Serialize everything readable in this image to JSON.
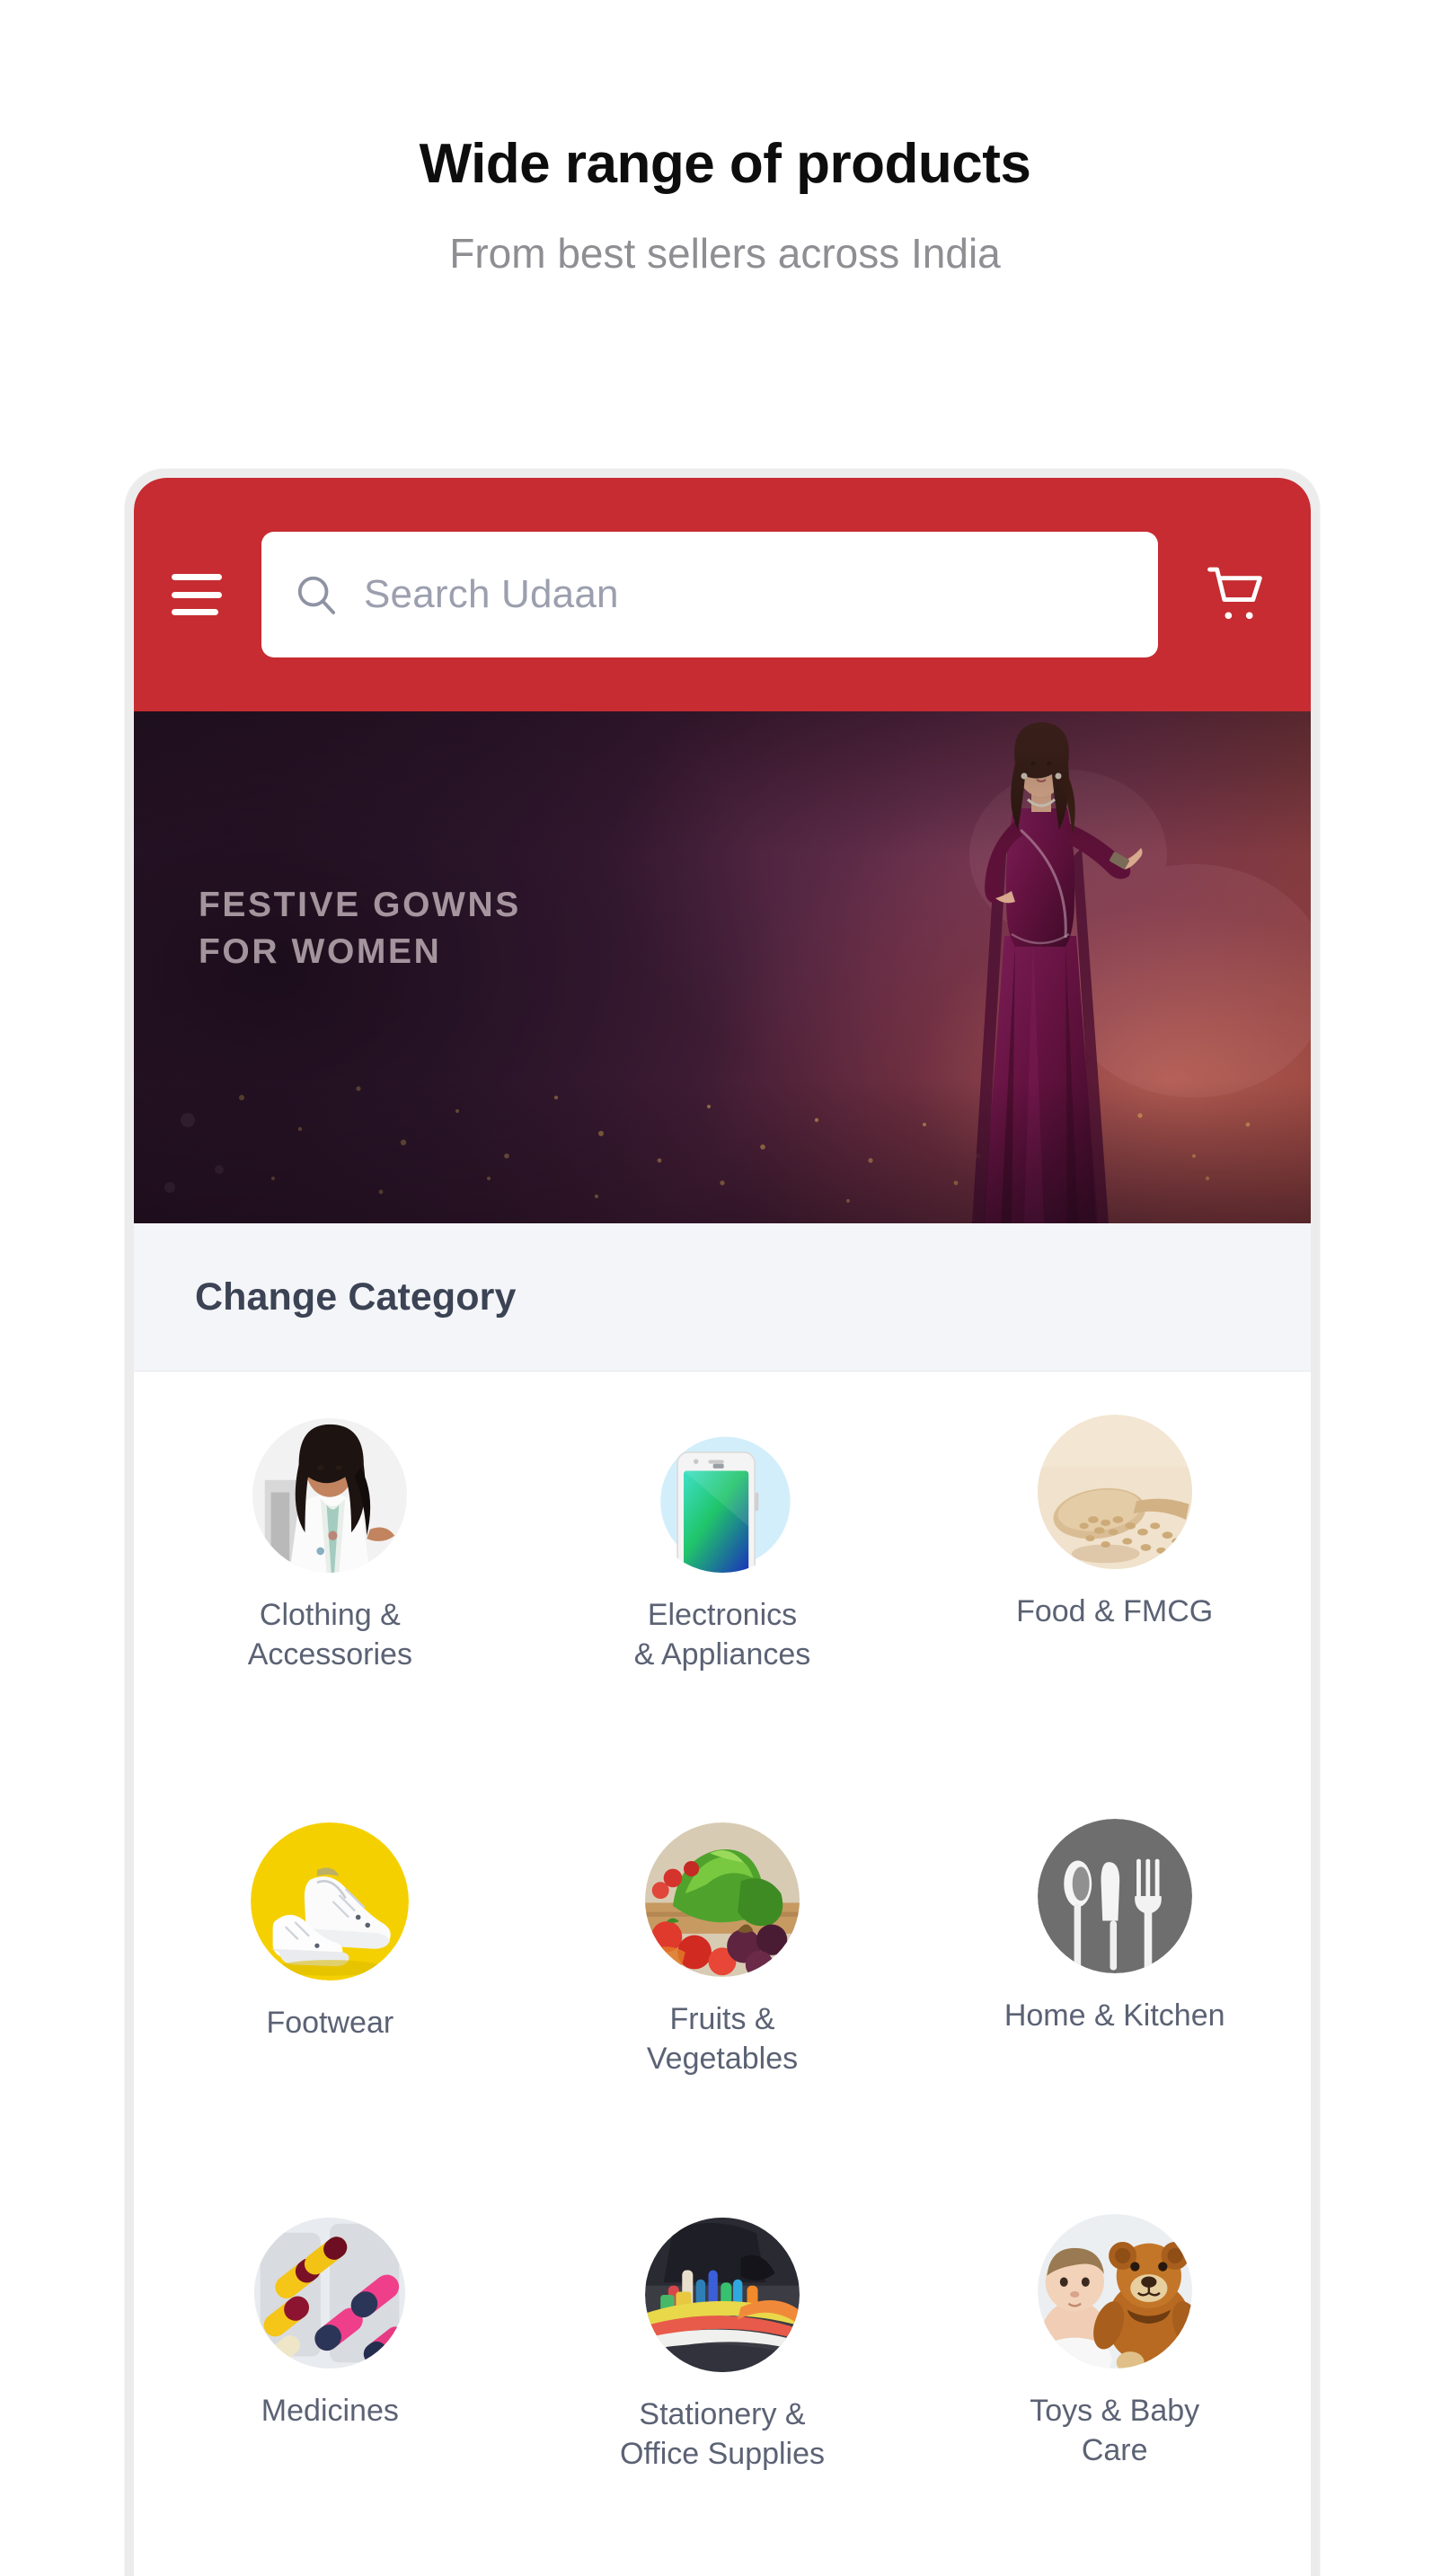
{
  "promo": {
    "title": "Wide range of products",
    "subtitle": "From best sellers across India"
  },
  "app": {
    "header": {
      "menu_icon": "hamburger-menu-icon",
      "cart_icon": "shopping-cart-icon",
      "accent_color": "#c62c31",
      "search": {
        "placeholder": "Search Udaan",
        "value": "",
        "icon": "search-icon"
      }
    },
    "hero": {
      "line1": "FESTIVE GOWNS",
      "line2": "FOR WOMEN",
      "image_alt": "woman-in-festive-gown"
    },
    "change_category": {
      "label": "Change Category"
    },
    "categories": [
      [
        {
          "label": "Clothing &\nAccessories",
          "icon": "clothing-icon",
          "name": "clothing-accessories"
        },
        {
          "label": "Electronics\n& Appliances",
          "icon": "smartphone-icon",
          "name": "electronics-appliances"
        },
        {
          "label": "Food & FMCG",
          "icon": "grains-spoon-icon",
          "name": "food-fmcg"
        }
      ],
      [
        {
          "label": "Footwear",
          "icon": "sneakers-icon",
          "name": "footwear"
        },
        {
          "label": "Fruits &\nVegetables",
          "icon": "vegetables-icon",
          "name": "fruits-vegetables"
        },
        {
          "label": "Home & Kitchen",
          "icon": "cutlery-icon",
          "name": "home-kitchen"
        }
      ],
      [
        {
          "label": "Medicines",
          "icon": "capsules-icon",
          "name": "medicines"
        },
        {
          "label": "Stationery &\nOffice Supplies",
          "icon": "stationery-icon",
          "name": "stationery-office-supplies"
        },
        {
          "label": "Toys & Baby\nCare",
          "icon": "teddy-bear-icon",
          "name": "toys-baby-care"
        }
      ]
    ]
  }
}
